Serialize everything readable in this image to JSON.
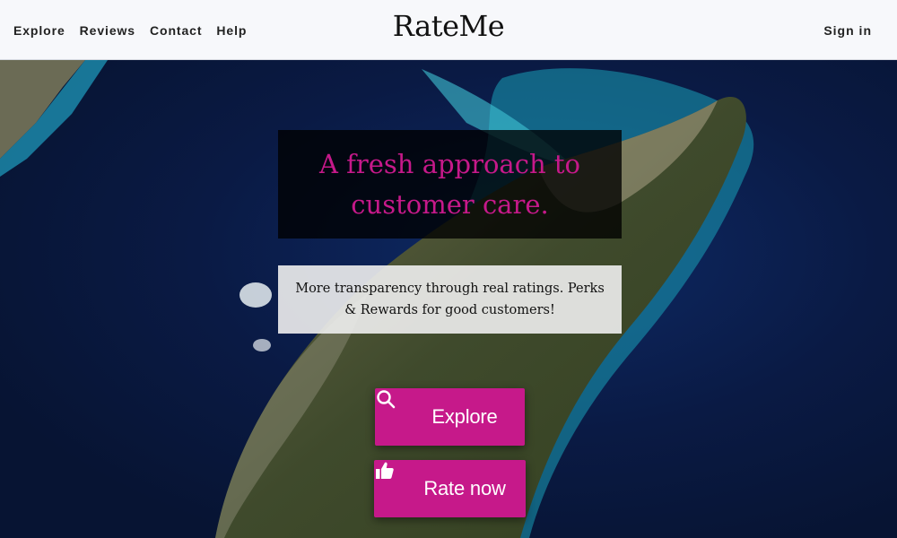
{
  "header": {
    "nav": [
      "Explore",
      "Reviews",
      "Contact",
      "Help"
    ],
    "brand": "RateMe",
    "signin": "Sign in"
  },
  "hero": {
    "headline": "A fresh approach to customer care.",
    "subtext": "More transparency through real ratings. Perks & Rewards for good customers!",
    "buttons": {
      "explore": {
        "label": "Explore",
        "icon": "search-icon"
      },
      "rate": {
        "label": "Rate now",
        "icon": "thumbs-up-icon"
      }
    }
  },
  "colors": {
    "accent": "#c6198a",
    "header_bg": "#f7f8fb",
    "ocean": "#0a1a44"
  }
}
